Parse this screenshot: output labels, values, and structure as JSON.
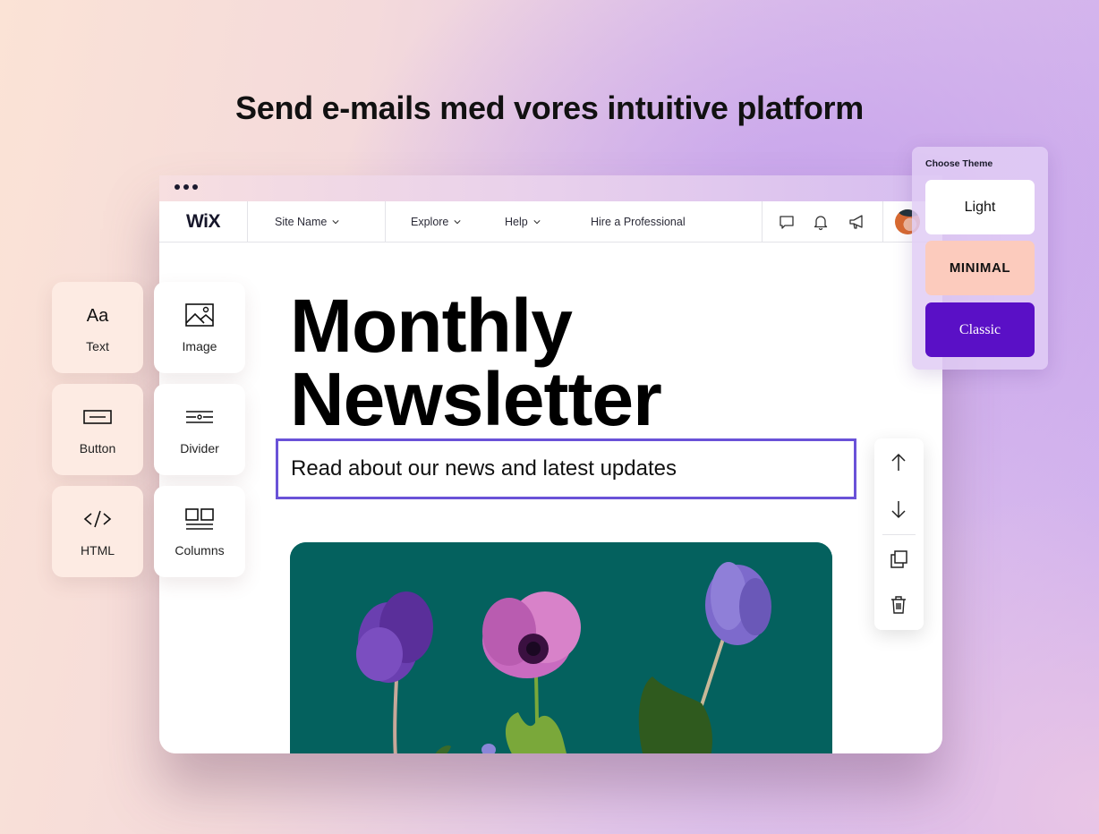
{
  "headline": "Send e-mails med vores intuitive platform",
  "window": {
    "titlebar_dots_icon": "more-dots-icon",
    "navbar": {
      "logo": "WiX",
      "site_name": "Site Name",
      "explore": "Explore",
      "help": "Help",
      "hire": "Hire a Professional",
      "icons": [
        "chat-icon",
        "bell-icon",
        "megaphone-icon",
        "avatar"
      ]
    },
    "content": {
      "title_line1": "Monthly",
      "title_line2": "Newsletter",
      "subtitle": "Read about our news and latest updates",
      "image_alt": "Purple and pink anemone flowers on teal background"
    }
  },
  "blocks": [
    {
      "label": "Text",
      "icon": "text-aa-icon"
    },
    {
      "label": "Image",
      "icon": "image-icon"
    },
    {
      "label": "Button",
      "icon": "button-icon"
    },
    {
      "label": "Divider",
      "icon": "divider-icon"
    },
    {
      "label": "HTML",
      "icon": "code-icon"
    },
    {
      "label": "Columns",
      "icon": "columns-icon"
    }
  ],
  "side_toolbar": [
    "move-up-icon",
    "move-down-icon",
    "duplicate-icon",
    "delete-icon"
  ],
  "theme_panel": {
    "title": "Choose Theme",
    "options": [
      {
        "label": "Light",
        "color": "#ffffff"
      },
      {
        "label": "MINIMAL",
        "color": "#fccbbd"
      },
      {
        "label": "Classic",
        "color": "#5a10c6"
      }
    ]
  },
  "colors": {
    "selection_border": "#6a52d8",
    "image_bg": "#04615e"
  }
}
